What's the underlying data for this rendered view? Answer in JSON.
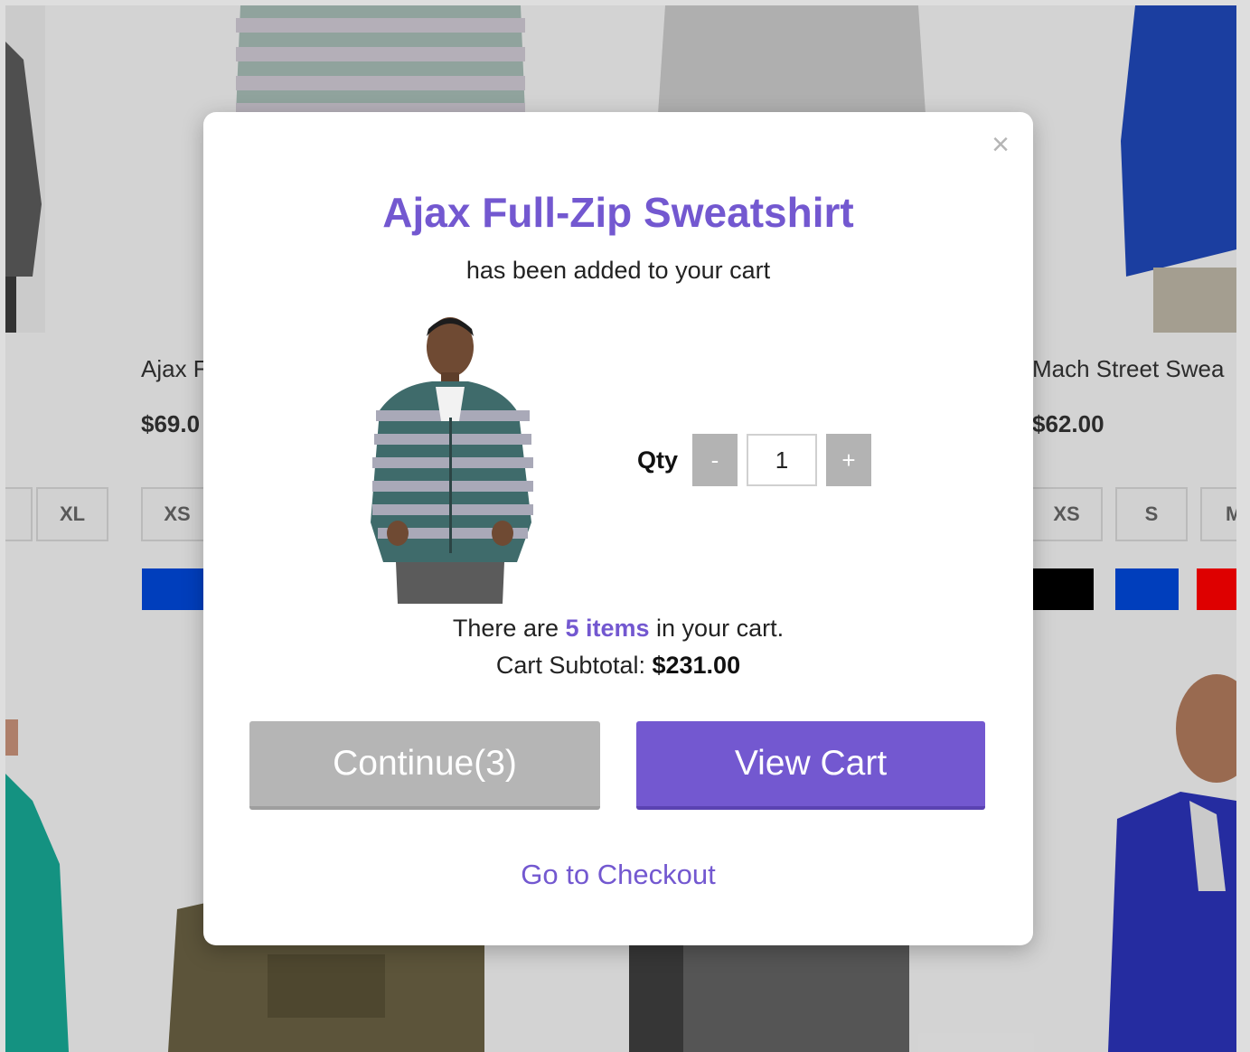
{
  "background": {
    "products": [
      {
        "name": "Ajax F",
        "price": "$69.0",
        "sizes": [
          "XS"
        ],
        "colors": [
          "#0048d8"
        ]
      },
      {
        "name": "Mach Street Swea",
        "price": "$62.00",
        "sizes": [
          "XS",
          "S",
          "M"
        ],
        "colors": [
          "#000000",
          "#0048d8",
          "#ff0000"
        ]
      }
    ],
    "left_edge_size": "XL"
  },
  "modal": {
    "title": "Ajax Full-Zip Sweatshirt",
    "subtitle": "has been added to your cart",
    "qty_label": "Qty",
    "qty_minus": "-",
    "qty_value": "1",
    "qty_plus": "+",
    "cart_text_before": "There are ",
    "cart_count": "5 items",
    "cart_text_after": " in your cart.",
    "subtotal_label": "Cart Subtotal: ",
    "subtotal_value": "$231.00",
    "continue_label": "Continue(3)",
    "view_cart_label": "View Cart",
    "checkout_label": "Go to Checkout",
    "close_symbol": "×"
  },
  "colors": {
    "accent": "#7358d0",
    "continue_button": "#b5b5b5"
  }
}
